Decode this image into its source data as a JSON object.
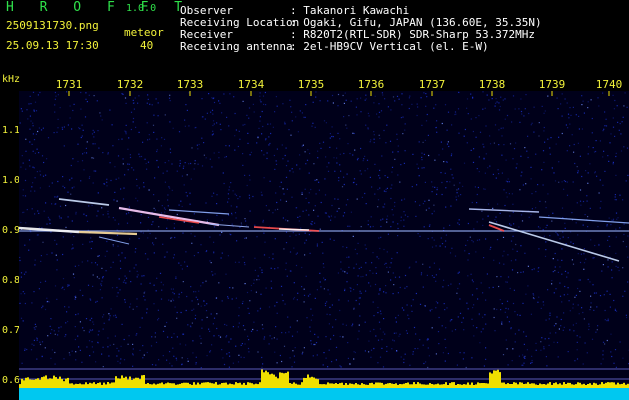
{
  "header": {
    "brand": "H R O F F T",
    "version": "1.0.0",
    "filename": "2509131730.png",
    "datetime": "25.09.13 17:30",
    "meteor_label": "meteor",
    "meteor_count": "40",
    "fields": [
      {
        "label": "Observer",
        "value": ": Takanori Kawachi"
      },
      {
        "label": "Receiving Location",
        "value": ": Ogaki, Gifu, JAPAN (136.60E, 35.35N)"
      },
      {
        "label": "Receiver",
        "value": ": R820T2(RTL-SDR) SDR-Sharp 53.372MHz"
      },
      {
        "label": "Receiving antenna",
        "value": ": 2el-HB9CV Vertical (el. E-W)"
      }
    ]
  },
  "axes": {
    "y_unit": "kHz",
    "x_ticks": [
      "1731",
      "1732",
      "1733",
      "1734",
      "1735",
      "1736",
      "1737",
      "1738",
      "1739",
      "1740"
    ],
    "y_ticks": [
      "1.1",
      "1.0",
      "0.9",
      "0.8",
      "0.7",
      "0.6"
    ]
  },
  "colors": {
    "background": "#00001a",
    "noise": "#1a30c8",
    "signal": "#ffffff",
    "trace": "#ff5050",
    "power": "#f0e000",
    "baseline": "#00c8f0"
  }
}
